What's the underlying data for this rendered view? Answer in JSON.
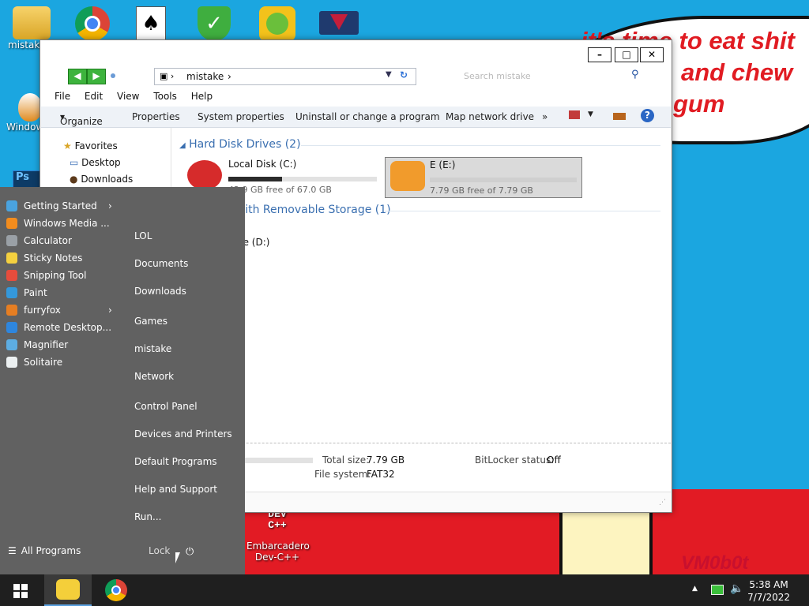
{
  "wallpaper": {
    "speech_line1": "it's time to eat shit",
    "speech_line2": "and chew",
    "speech_line3": "gum",
    "signature": "VM0b0t"
  },
  "desktop_icons": [
    {
      "label": "mistake"
    },
    {
      "label": "Windows Vista"
    },
    {
      "label": "Embarcadero Dev-C++"
    }
  ],
  "explorer": {
    "address_crumb": "mistake",
    "search_placeholder": "Search mistake",
    "menu": [
      "File",
      "Edit",
      "View",
      "Tools",
      "Help"
    ],
    "commands": [
      "Organize",
      "Properties",
      "System properties",
      "Uninstall or change a program",
      "Map network drive",
      "»"
    ],
    "nav": {
      "favorites": "Favorites",
      "desktop": "Desktop",
      "downloads": "Downloads"
    },
    "group_hdd": "Hard Disk Drives (2)",
    "group_removable": "Devices with Removable Storage (1)",
    "drives": [
      {
        "name": "Local Disk (C:)",
        "free": "42.9 GB free of 67.0 GB",
        "used_fraction": 0.36
      },
      {
        "name": "E (E:)",
        "free": "7.79 GB free of 7.79 GB",
        "used_fraction": 0.0
      }
    ],
    "removable_drive": "Drive (D:)",
    "details": {
      "total_size_label": "Total size:",
      "total_size_value": "7.79 GB",
      "fs_label": "File system:",
      "fs_value": "FAT32",
      "bitlocker_label": "BitLocker status:",
      "bitlocker_value": "Off"
    }
  },
  "start_menu": {
    "programs": [
      {
        "label": "Getting Started",
        "color": "#4aa3df",
        "arrow": true
      },
      {
        "label": "Windows Media ...",
        "color": "#f28c1e",
        "arrow": false
      },
      {
        "label": "Calculator",
        "color": "#9aa0a6",
        "arrow": false
      },
      {
        "label": "Sticky Notes",
        "color": "#f4d03f",
        "arrow": false
      },
      {
        "label": "Snipping Tool",
        "color": "#e74c3c",
        "arrow": false
      },
      {
        "label": "Paint",
        "color": "#3498db",
        "arrow": false
      },
      {
        "label": "furryfox",
        "color": "#e67e22",
        "arrow": true
      },
      {
        "label": "Remote Desktop...",
        "color": "#2e86de",
        "arrow": false
      },
      {
        "label": "Magnifier",
        "color": "#5dade2",
        "arrow": false
      },
      {
        "label": "Solitaire",
        "color": "#ecf0f1",
        "arrow": false
      }
    ],
    "right_items": [
      "LOL",
      "Documents",
      "Downloads",
      "Games",
      "mistake",
      "Network",
      "Control Panel",
      "Devices and Printers",
      "Default Programs",
      "Help and Support",
      "Run..."
    ],
    "all_programs": "All Programs",
    "lock": "Lock"
  },
  "taskbar": {
    "time": "5:38 AM",
    "date": "7/7/2022"
  }
}
